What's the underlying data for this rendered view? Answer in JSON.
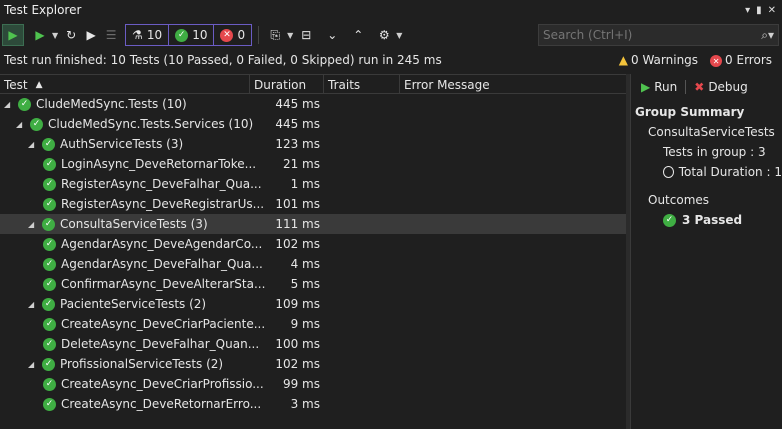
{
  "window": {
    "title": "Test Explorer"
  },
  "toolbar": {
    "counters": [
      {
        "icon": "flask-icon",
        "value": "10"
      },
      {
        "icon": "passed-icon",
        "value": "10"
      },
      {
        "icon": "failed-icon",
        "value": "0"
      }
    ],
    "search_placeholder": "Search (Ctrl+I)"
  },
  "status": {
    "summary": "Test run finished: 10 Tests (10 Passed, 0 Failed, 0 Skipped) run in 245 ms",
    "warnings": "0 Warnings",
    "errors": "0 Errors"
  },
  "columns": [
    "Test",
    "Duration",
    "Traits",
    "Error Message"
  ],
  "tests": [
    {
      "name": "CludeMedSync.Tests (10)",
      "duration": "445 ms",
      "level": 0,
      "expandable": true,
      "selected": false
    },
    {
      "name": "CludeMedSync.Tests.Services (10)",
      "duration": "445 ms",
      "level": 1,
      "expandable": true,
      "selected": false
    },
    {
      "name": "AuthServiceTests (3)",
      "duration": "123 ms",
      "level": 2,
      "expandable": true,
      "selected": false
    },
    {
      "name": "LoginAsync_DeveRetornarToke...",
      "duration": "21 ms",
      "level": 3,
      "expandable": false,
      "selected": false
    },
    {
      "name": "RegisterAsync_DeveFalhar_Qua...",
      "duration": "1 ms",
      "level": 3,
      "expandable": false,
      "selected": false
    },
    {
      "name": "RegisterAsync_DeveRegistrarUs...",
      "duration": "101 ms",
      "level": 3,
      "expandable": false,
      "selected": false
    },
    {
      "name": "ConsultaServiceTests (3)",
      "duration": "111 ms",
      "level": 2,
      "expandable": true,
      "selected": true
    },
    {
      "name": "AgendarAsync_DeveAgendarCo...",
      "duration": "102 ms",
      "level": 3,
      "expandable": false,
      "selected": false
    },
    {
      "name": "AgendarAsync_DeveFalhar_Qua...",
      "duration": "4 ms",
      "level": 3,
      "expandable": false,
      "selected": false
    },
    {
      "name": "ConfirmarAsync_DeveAlterarSta...",
      "duration": "5 ms",
      "level": 3,
      "expandable": false,
      "selected": false
    },
    {
      "name": "PacienteServiceTests (2)",
      "duration": "109 ms",
      "level": 2,
      "expandable": true,
      "selected": false
    },
    {
      "name": "CreateAsync_DeveCriarPaciente...",
      "duration": "9 ms",
      "level": 3,
      "expandable": false,
      "selected": false
    },
    {
      "name": "DeleteAsync_DeveFalhar_Quan...",
      "duration": "100 ms",
      "level": 3,
      "expandable": false,
      "selected": false
    },
    {
      "name": "ProfissionalServiceTests (2)",
      "duration": "102 ms",
      "level": 2,
      "expandable": true,
      "selected": false
    },
    {
      "name": "CreateAsync_DeveCriarProfissio...",
      "duration": "99 ms",
      "level": 3,
      "expandable": false,
      "selected": false
    },
    {
      "name": "CreateAsync_DeveRetornarErro...",
      "duration": "3 ms",
      "level": 3,
      "expandable": false,
      "selected": false
    }
  ],
  "summary_panel": {
    "run_label": "Run",
    "debug_label": "Debug",
    "heading": "Group Summary",
    "group_name": "ConsultaServiceTests",
    "tests_in_group_label": "Tests in group :",
    "tests_in_group_value": "3",
    "total_duration_label": "Total Duration :",
    "total_duration_value": "1",
    "outcomes_label": "Outcomes",
    "passed_label": "3 Passed"
  },
  "colors": {
    "passed": "#3fae43",
    "failed": "#e5484d",
    "warning": "#f3c33b",
    "selected_row": "#3a3a3a"
  }
}
